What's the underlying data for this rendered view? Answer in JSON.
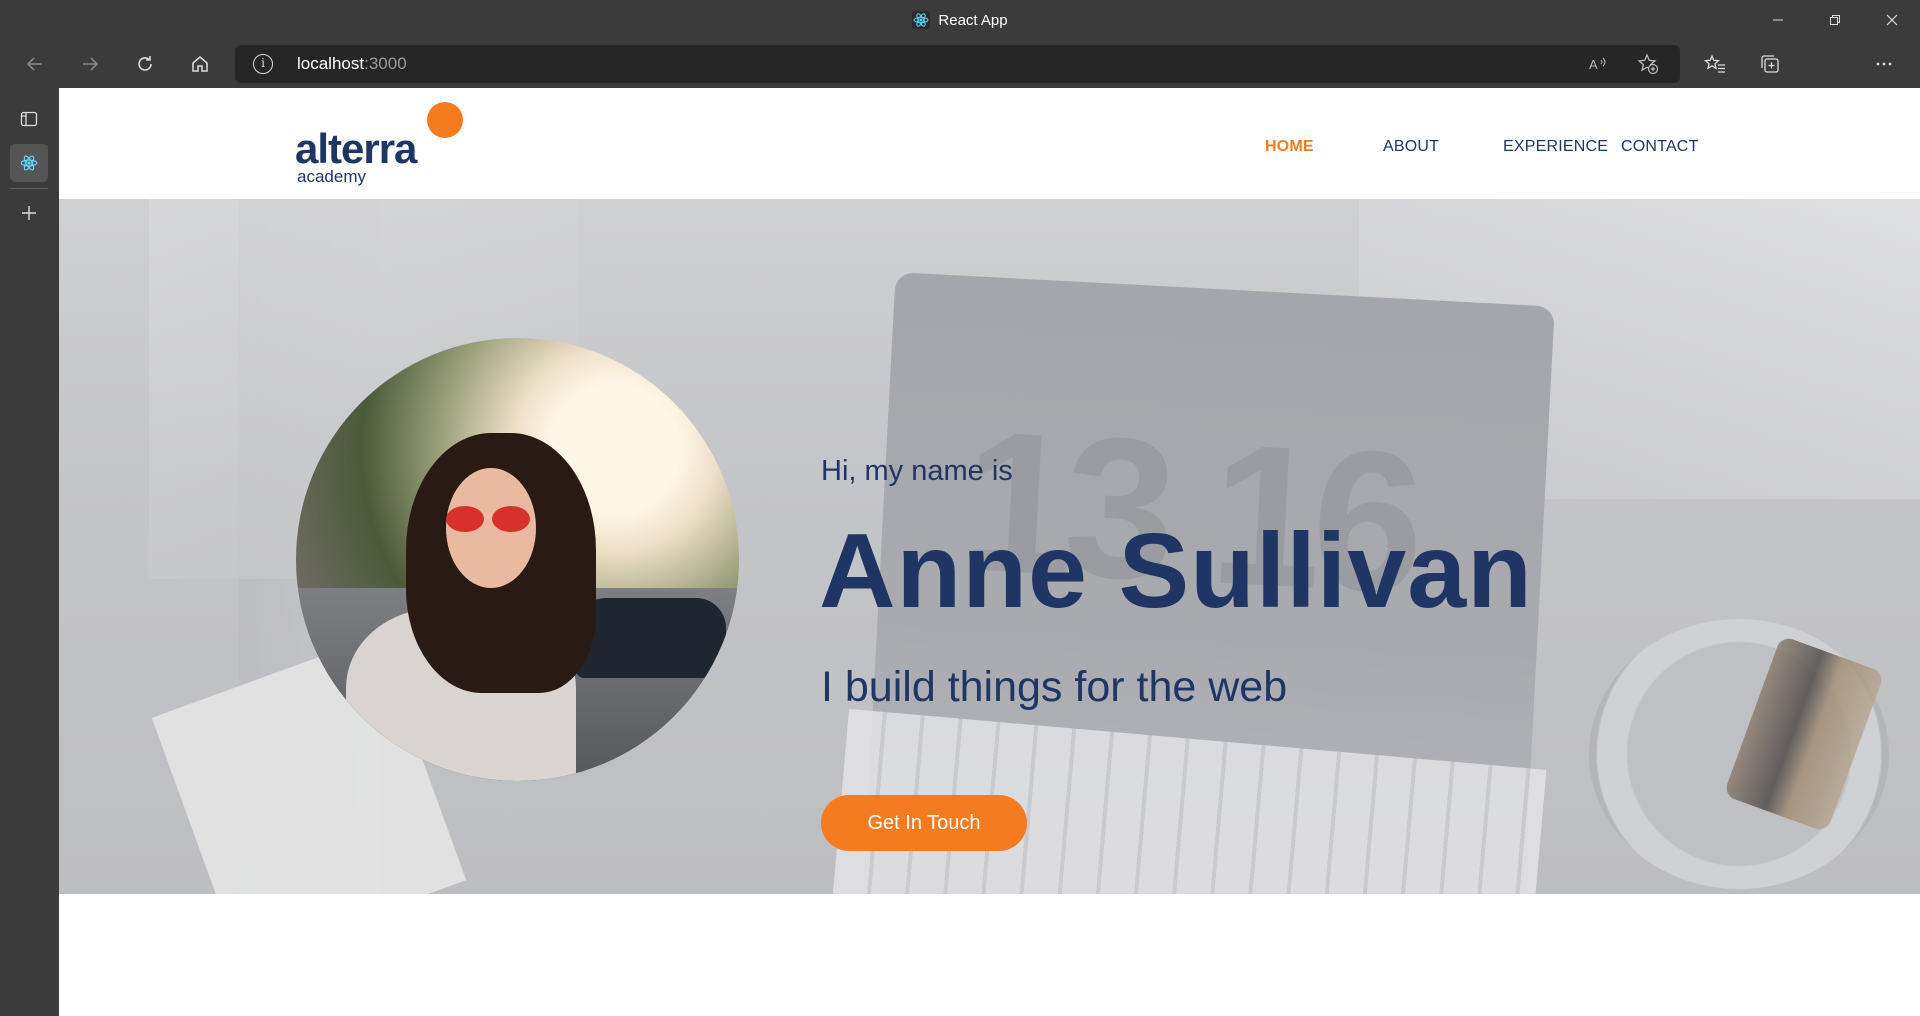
{
  "browser": {
    "tab_title": "React App",
    "url_host": "localhost",
    "url_port": ":3000"
  },
  "navbar": {
    "logo_word": "alterra",
    "logo_sub": "academy",
    "links": [
      {
        "label": "HOME",
        "active": true
      },
      {
        "label": "ABOUT",
        "active": false
      },
      {
        "label": "EXPERIENCE",
        "active": false
      },
      {
        "label": "CONTACT",
        "active": false
      }
    ]
  },
  "hero": {
    "intro": "Hi, my name is",
    "name": "Anne Sullivan",
    "tagline": "I build things for the web",
    "cta_label": "Get In Touch"
  },
  "colors": {
    "brand_navy": "#1f3564",
    "brand_orange": "#f47b20"
  }
}
